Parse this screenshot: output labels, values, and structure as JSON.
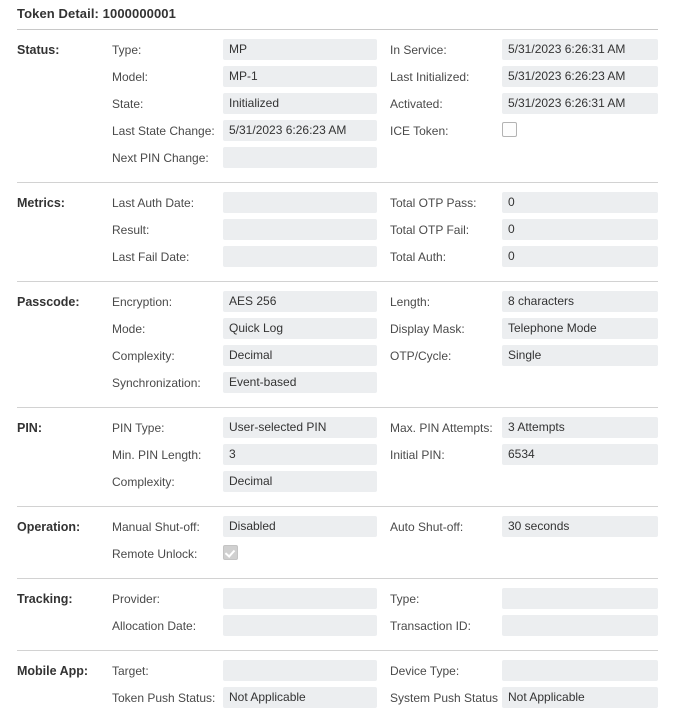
{
  "header": {
    "title": "Token Detail: 1000000001"
  },
  "sections": [
    {
      "id": "status",
      "label": "Status:",
      "rows": [
        {
          "left": {
            "label": "Type:",
            "value": "MP",
            "kind": "text"
          },
          "right": {
            "label": "In Service:",
            "value": "5/31/2023 6:26:31 AM",
            "kind": "text"
          }
        },
        {
          "left": {
            "label": "Model:",
            "value": "MP-1",
            "kind": "text"
          },
          "right": {
            "label": "Last Initialized:",
            "value": "5/31/2023 6:26:23 AM",
            "kind": "text"
          }
        },
        {
          "left": {
            "label": "State:",
            "value": "Initialized",
            "kind": "text"
          },
          "right": {
            "label": "Activated:",
            "value": "5/31/2023 6:26:31 AM",
            "kind": "text"
          }
        },
        {
          "left": {
            "label": "Last State Change:",
            "value": "5/31/2023 6:26:23 AM",
            "kind": "text"
          },
          "right": {
            "label": "ICE Token:",
            "value": "",
            "kind": "checkbox",
            "checked": false
          }
        },
        {
          "left": {
            "label": "Next PIN Change:",
            "value": "",
            "kind": "text"
          },
          "right": null
        }
      ]
    },
    {
      "id": "metrics",
      "label": "Metrics:",
      "rows": [
        {
          "left": {
            "label": "Last Auth Date:",
            "value": "",
            "kind": "text"
          },
          "right": {
            "label": "Total OTP Pass:",
            "value": "0",
            "kind": "text"
          }
        },
        {
          "left": {
            "label": "Result:",
            "value": "",
            "kind": "text"
          },
          "right": {
            "label": "Total OTP Fail:",
            "value": "0",
            "kind": "text"
          }
        },
        {
          "left": {
            "label": "Last Fail Date:",
            "value": "",
            "kind": "text"
          },
          "right": {
            "label": "Total Auth:",
            "value": "0",
            "kind": "text"
          }
        }
      ]
    },
    {
      "id": "passcode",
      "label": "Passcode:",
      "rows": [
        {
          "left": {
            "label": "Encryption:",
            "value": "AES 256",
            "kind": "text"
          },
          "right": {
            "label": "Length:",
            "value": "8 characters",
            "kind": "text"
          }
        },
        {
          "left": {
            "label": "Mode:",
            "value": "Quick Log",
            "kind": "text"
          },
          "right": {
            "label": "Display Mask:",
            "value": "Telephone Mode",
            "kind": "text"
          }
        },
        {
          "left": {
            "label": "Complexity:",
            "value": "Decimal",
            "kind": "text"
          },
          "right": {
            "label": "OTP/Cycle:",
            "value": "Single",
            "kind": "text"
          }
        },
        {
          "left": {
            "label": "Synchronization:",
            "value": "Event-based",
            "kind": "text"
          },
          "right": null
        }
      ]
    },
    {
      "id": "pin",
      "label": "PIN:",
      "rows": [
        {
          "left": {
            "label": "PIN Type:",
            "value": "User-selected PIN",
            "kind": "text"
          },
          "right": {
            "label": "Max. PIN Attempts:",
            "value": "3 Attempts",
            "kind": "text"
          }
        },
        {
          "left": {
            "label": "Min. PIN Length:",
            "value": "3",
            "kind": "text"
          },
          "right": {
            "label": "Initial PIN:",
            "value": "6534",
            "kind": "text"
          }
        },
        {
          "left": {
            "label": "Complexity:",
            "value": "Decimal",
            "kind": "text"
          },
          "right": null
        }
      ]
    },
    {
      "id": "operation",
      "label": "Operation:",
      "rows": [
        {
          "left": {
            "label": "Manual Shut-off:",
            "value": "Disabled",
            "kind": "text"
          },
          "right": {
            "label": "Auto Shut-off:",
            "value": "30 seconds",
            "kind": "text"
          }
        },
        {
          "left": {
            "label": "Remote Unlock:",
            "value": "",
            "kind": "checkbox",
            "checked": true
          },
          "right": null
        }
      ]
    },
    {
      "id": "tracking",
      "label": "Tracking:",
      "rows": [
        {
          "left": {
            "label": "Provider:",
            "value": "",
            "kind": "text"
          },
          "right": {
            "label": "Type:",
            "value": "",
            "kind": "text"
          }
        },
        {
          "left": {
            "label": "Allocation Date:",
            "value": "",
            "kind": "text"
          },
          "right": {
            "label": "Transaction ID:",
            "value": "",
            "kind": "text"
          }
        }
      ]
    },
    {
      "id": "mobile-app",
      "label": "Mobile App:",
      "rows": [
        {
          "left": {
            "label": "Target:",
            "value": "",
            "kind": "text"
          },
          "right": {
            "label": "Device Type:",
            "value": "",
            "kind": "text"
          }
        },
        {
          "left": {
            "label": "Token Push Status:",
            "value": "Not Applicable",
            "kind": "text"
          },
          "right": {
            "label": "System Push Status",
            "value": "Not Applicable",
            "kind": "text"
          }
        }
      ]
    }
  ]
}
